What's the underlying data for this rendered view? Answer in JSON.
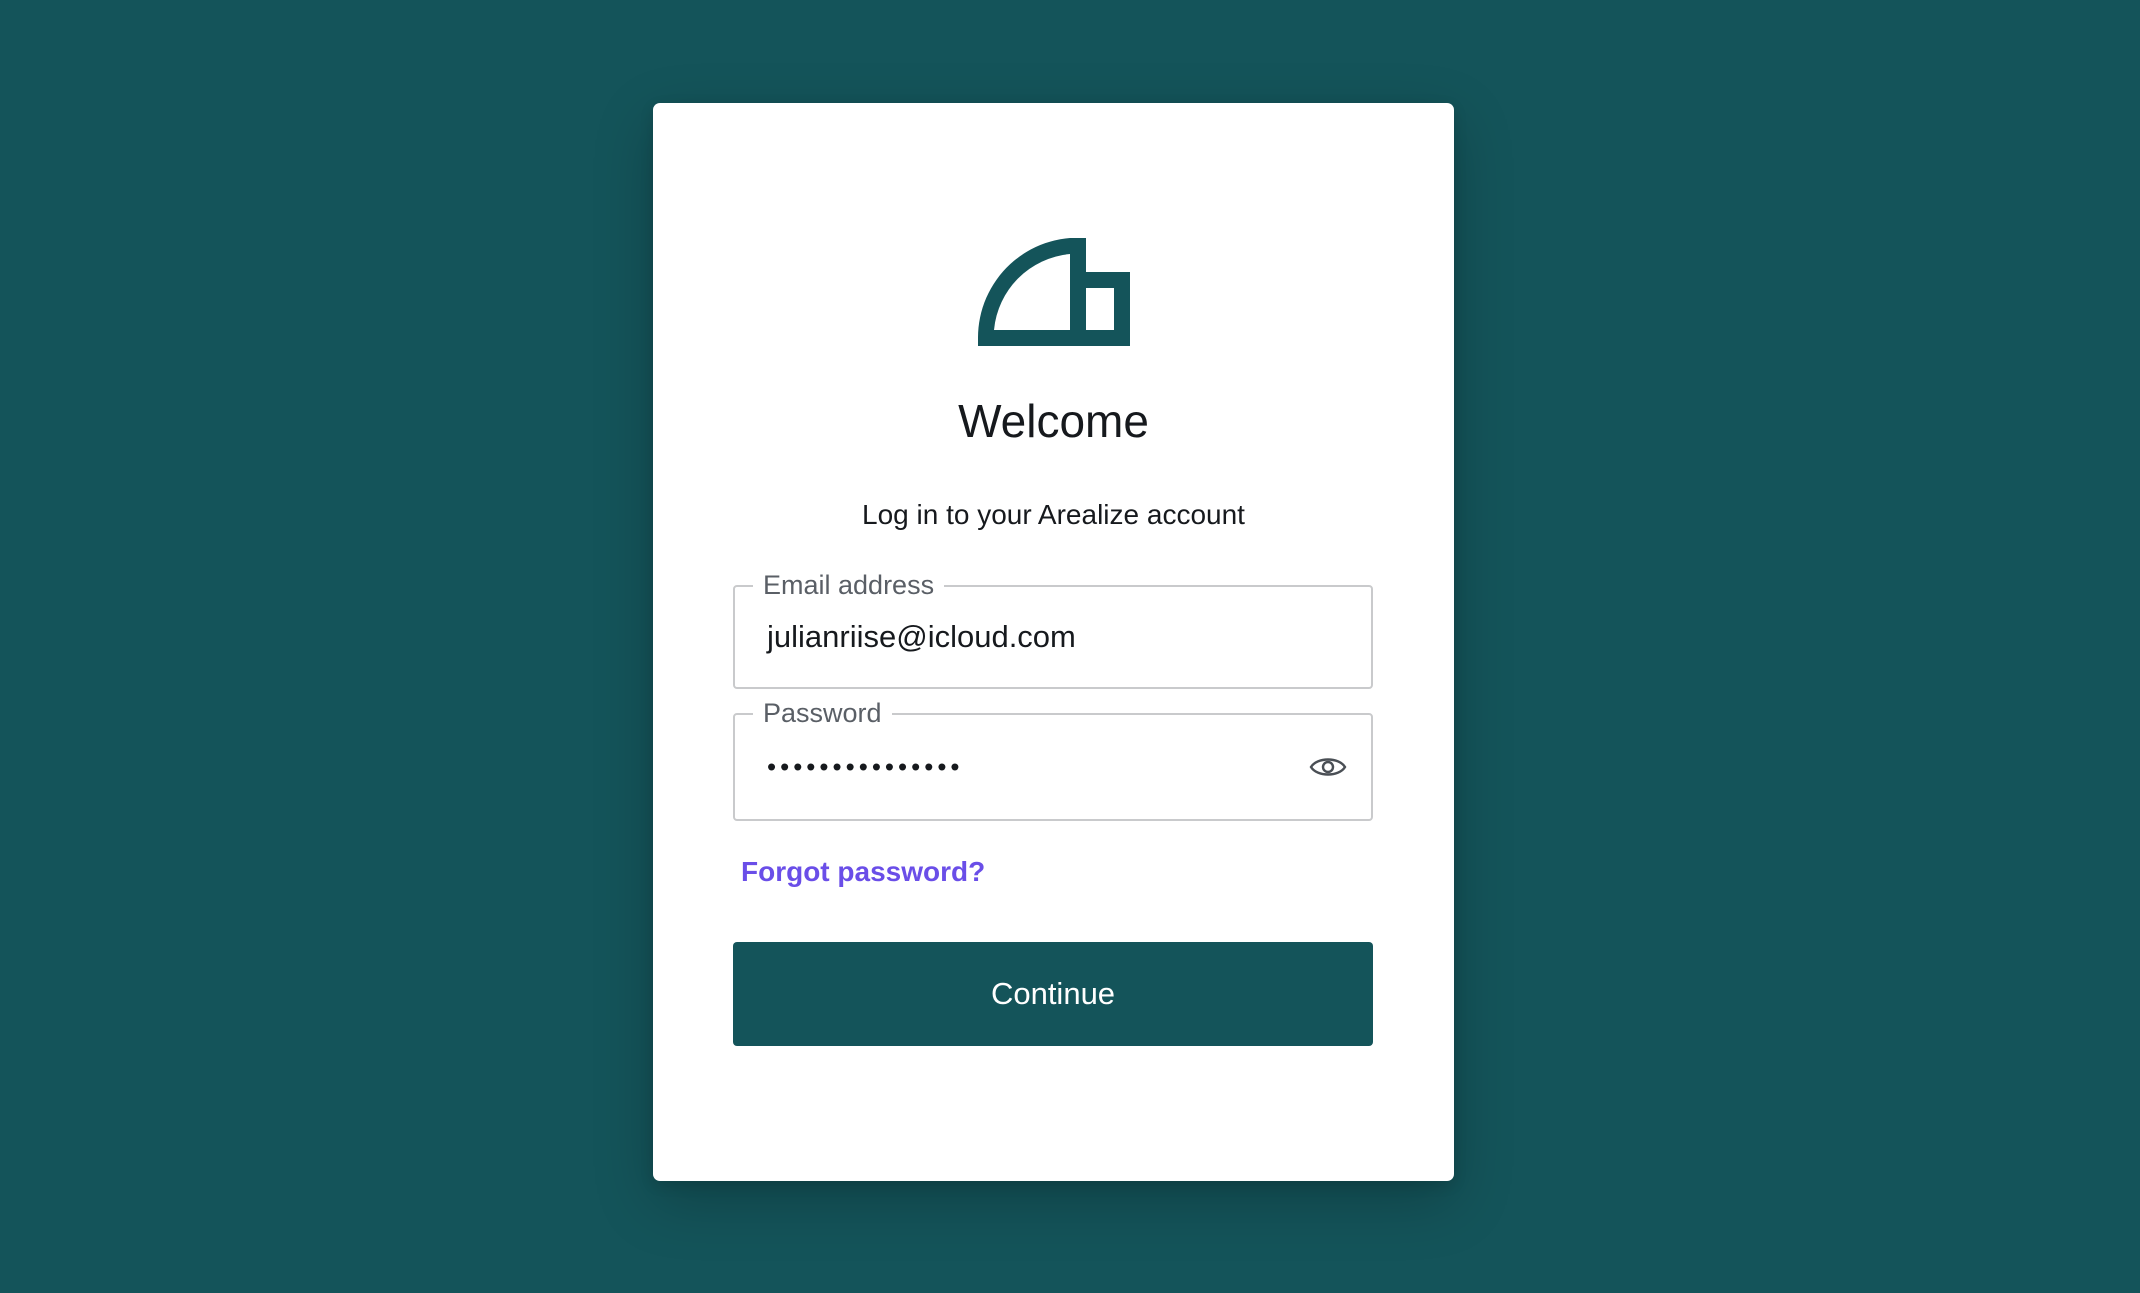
{
  "colors": {
    "background": "#14545a",
    "card": "#ffffff",
    "brand": "#14545a",
    "link": "#6a4ee8",
    "text": "#16191d",
    "label": "#5a5f66",
    "field_border": "#c9cacc"
  },
  "logo": {
    "icon": "arealize-logo-icon"
  },
  "header": {
    "title": "Welcome",
    "subtitle": "Log in to your Arealize account"
  },
  "form": {
    "email": {
      "label": "Email address",
      "value": "julianriise@icloud.com"
    },
    "password": {
      "label": "Password",
      "masked_value": "•••••••••••••••",
      "toggle_icon": "eye-icon"
    },
    "forgot_password_label": "Forgot password?",
    "continue_label": "Continue"
  }
}
